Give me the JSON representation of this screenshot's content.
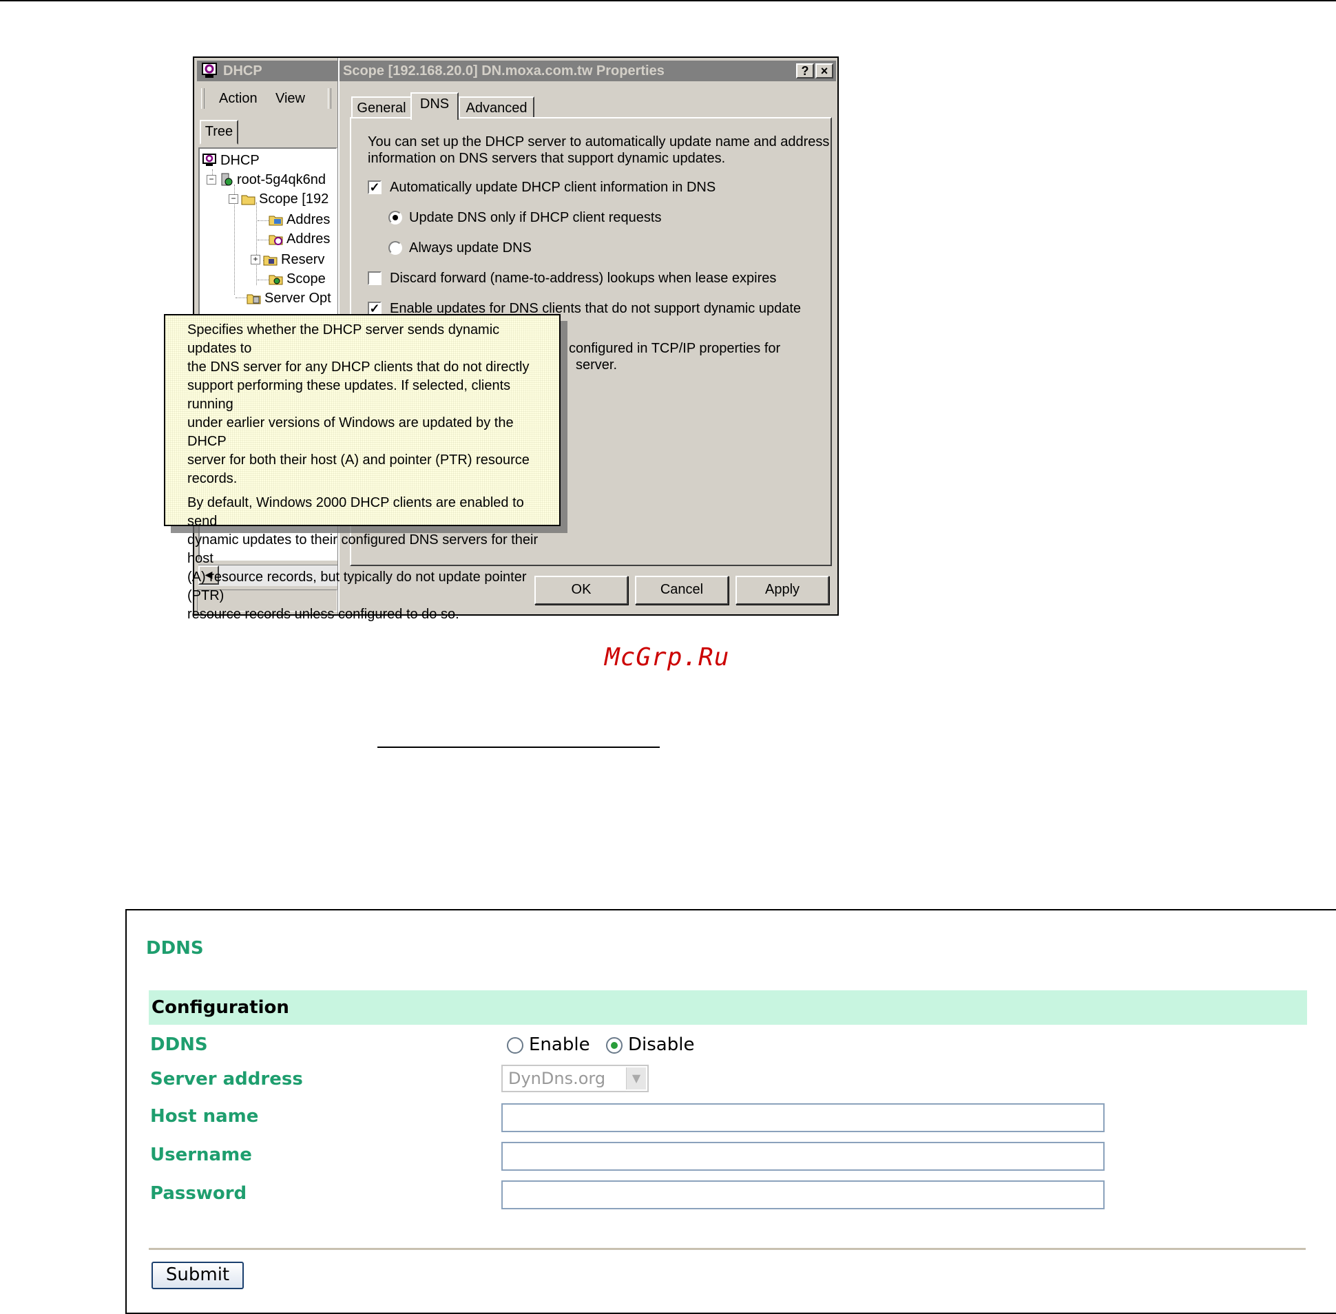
{
  "mmc": {
    "title": "DHCP",
    "menu": [
      "Action",
      "View"
    ],
    "tree_tab": "Tree",
    "tree": [
      {
        "label": "DHCP",
        "icon": "dhcp-icon"
      },
      {
        "label": "root-5g4qk6nd",
        "icon": "server-icon"
      },
      {
        "label": "Scope [192",
        "icon": "folder-icon"
      },
      {
        "label": "Addres",
        "icon": "address-pool-icon"
      },
      {
        "label": "Addres",
        "icon": "address-leases-icon"
      },
      {
        "label": "Reserv",
        "icon": "reservations-icon"
      },
      {
        "label": "Scope",
        "icon": "scope-options-icon"
      },
      {
        "label": "Server Opt",
        "icon": "server-options-icon"
      }
    ]
  },
  "dialog": {
    "title": "Scope [192.168.20.0] DN.moxa.com.tw Properties",
    "help_button": "?",
    "close_button": "×",
    "tabs": [
      "General",
      "DNS",
      "Advanced"
    ],
    "active_tab": "DNS",
    "intro_line1": "You can set up the DHCP server to automatically update name and address",
    "intro_line2": "information on DNS servers that support dynamic updates.",
    "auto_update_label": "Automatically update DHCP client information in DNS",
    "auto_update_checked": true,
    "radio_update_requests": "Update DNS only if DHCP client requests",
    "radio_always_update": "Always update DNS",
    "discard_label": "Discard forward (name-to-address) lookups when lease expires",
    "discard_checked": false,
    "enable_updates_label": "Enable updates for DNS clients that do not support dynamic update",
    "enable_updates_checked": true,
    "partial_line1": "configured in TCP/IP properties for",
    "partial_line2": "server.",
    "ok": "OK",
    "cancel": "Cancel",
    "apply": "Apply"
  },
  "tooltip": {
    "para1": [
      "Specifies whether the DHCP server sends dynamic updates to",
      "the DNS server for any DHCP clients that do not directly",
      "support performing these updates. If selected, clients running",
      "under earlier versions of Windows are updated by the DHCP",
      "server for both their host (A) and pointer (PTR) resource",
      "records."
    ],
    "para2": [
      "By default, Windows 2000 DHCP clients are enabled to send",
      "dynamic updates to their configured DNS servers for their host",
      "(A) resource records, but typically do not update pointer (PTR)",
      "resource records unless configured to do so."
    ]
  },
  "watermark": "McGrp.Ru",
  "ddns_page": {
    "title": "DDNS",
    "section": "Configuration",
    "labels": {
      "ddns": "DDNS",
      "server_address": "Server address",
      "host_name": "Host name",
      "username": "Username",
      "password": "Password"
    },
    "ddns_options": {
      "enable": "Enable",
      "disable": "Disable"
    },
    "ddns_selected": "Disable",
    "server_address_value": "DynDns.org",
    "host_name_value": "",
    "username_value": "",
    "password_value": "",
    "submit": "Submit",
    "colors": {
      "label": "#1e9e6e",
      "band": "#c8f5e0"
    }
  }
}
